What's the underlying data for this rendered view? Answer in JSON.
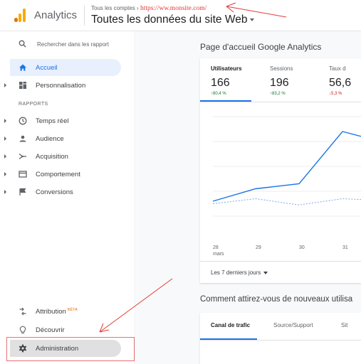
{
  "header": {
    "app_name": "Analytics",
    "breadcrumb_prefix": "Tous les comptes ›",
    "breadcrumb_url": "https://ww.monsite.com/",
    "view_title": "Toutes les données du site Web"
  },
  "sidebar": {
    "search_placeholder": "Rechercher dans les rapport",
    "home": "Accueil",
    "customization": "Personnalisation",
    "section_label": "RAPPORTS",
    "items": [
      {
        "label": "Temps réel",
        "icon": "clock-icon"
      },
      {
        "label": "Audience",
        "icon": "person-icon"
      },
      {
        "label": "Acquisition",
        "icon": "acquisition-icon"
      },
      {
        "label": "Comportement",
        "icon": "behavior-icon"
      },
      {
        "label": "Conversions",
        "icon": "flag-icon"
      }
    ],
    "attribution": "Attribution",
    "attribution_badge": "BÊTA",
    "discover": "Découvrir",
    "admin": "Administration"
  },
  "main": {
    "card_title": "Page d'accueil Google Analytics",
    "metrics": [
      {
        "label": "Utilisateurs",
        "value": "166",
        "change": "↑80,4 %",
        "direction": "up"
      },
      {
        "label": "Sessions",
        "value": "196",
        "change": "↑83,2 %",
        "direction": "up"
      },
      {
        "label": "Taux d",
        "value": "56,6",
        "change": "↓5,3 %",
        "direction": "down"
      }
    ],
    "chart_x_labels": [
      {
        "day": "28",
        "month": "mars"
      },
      {
        "day": "29",
        "month": ""
      },
      {
        "day": "30",
        "month": ""
      },
      {
        "day": "31",
        "month": ""
      }
    ],
    "date_range": "Les 7 derniers jours",
    "section2_title": "Comment attirez-vous de nouveaux utilisa",
    "tabs": [
      "Canal de trafic",
      "Source/Support",
      "Sit"
    ]
  },
  "colors": {
    "accent": "#1a73e8",
    "up": "#137333",
    "down": "#c5221f",
    "annotation": "#e53935",
    "logo_orange": "#e37400",
    "logo_yellow": "#f9ab00"
  },
  "chart_data": {
    "type": "line",
    "x": [
      "28 mars",
      "29",
      "30",
      "31",
      ""
    ],
    "series": [
      {
        "values": [
          12,
          22,
          26,
          68,
          62
        ]
      },
      {
        "values": [
          10,
          14,
          9,
          14,
          13
        ]
      }
    ]
  }
}
